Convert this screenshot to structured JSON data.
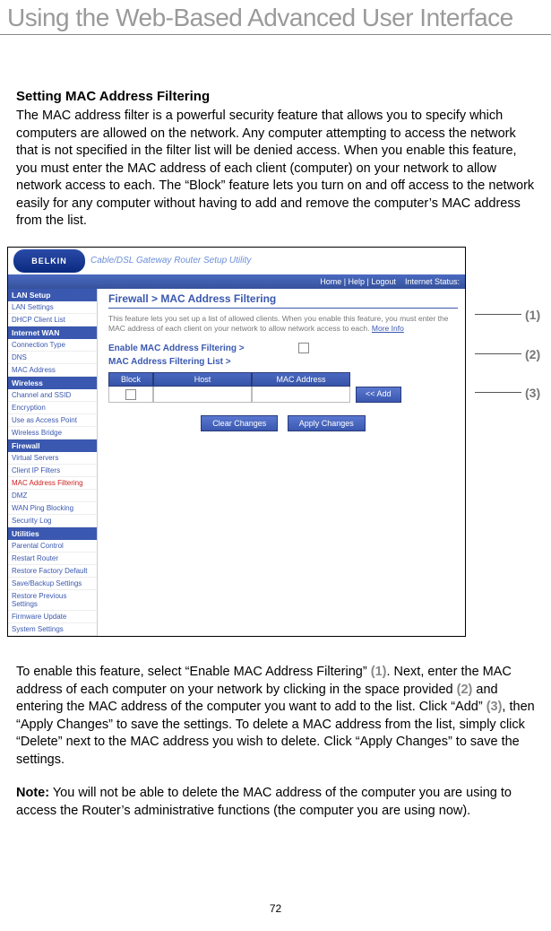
{
  "page": {
    "title": "Using the Web-Based Advanced User Interface",
    "number": "72"
  },
  "section": {
    "heading": "Setting MAC Address Filtering",
    "intro": "The MAC address filter is a powerful security feature that allows you to specify which computers are allowed on the network. Any computer attempting to access the network that is not specified in the filter list will be denied access. When you enable this feature, you must enter the MAC address of each client (computer) on your network to allow network access to each. The “Block” feature lets you turn on and off access to the network easily for any computer without having to add and remove the computer’s MAC address from the list."
  },
  "screenshot": {
    "logo_text": "BELKIN",
    "utility_title": "Cable/DSL Gateway Router Setup Utility",
    "topbar_links": "Home | Help | Logout",
    "topbar_status_label": "Internet Status:",
    "sidebar": {
      "groups": [
        {
          "head": "LAN Setup",
          "items": [
            "LAN Settings",
            "DHCP Client List"
          ]
        },
        {
          "head": "Internet WAN",
          "items": [
            "Connection Type",
            "DNS",
            "MAC Address"
          ]
        },
        {
          "head": "Wireless",
          "items": [
            "Channel and SSID",
            "Encryption",
            "Use as Access Point",
            "Wireless Bridge"
          ]
        },
        {
          "head": "Firewall",
          "items": [
            "Virtual Servers",
            "Client IP Filters",
            "MAC Address Filtering",
            "DMZ",
            "WAN Ping Blocking",
            "Security Log"
          ],
          "selected": "MAC Address Filtering"
        },
        {
          "head": "Utilities",
          "items": [
            "Parental Control",
            "Restart Router",
            "Restore Factory Default",
            "Save/Backup Settings",
            "Restore Previous Settings",
            "Firmware Update",
            "System Settings"
          ]
        }
      ]
    },
    "content": {
      "breadcrumb": "Firewall > MAC Address Filtering",
      "description": "This feature lets you set up a list of allowed clients. When you enable this feature, you must enter the MAC address of each client on your network to allow network access to each.",
      "more_info": "More Info",
      "enable_label": "Enable MAC Address Filtering >",
      "list_label": "MAC Address Filtering List >",
      "table": {
        "col_block": "Block",
        "col_host": "Host",
        "col_mac": "MAC Address"
      },
      "add_button": "<< Add",
      "clear_button": "Clear Changes",
      "apply_button": "Apply Changes"
    },
    "callouts": {
      "c1": "(1)",
      "c2": "(2)",
      "c3": "(3)"
    }
  },
  "instructions": {
    "p1a": "To enable this feature, select “Enable MAC Address Filtering” ",
    "p1b": ". Next, enter the MAC address of each computer on your network by clicking in the space provided ",
    "p1c": " and entering the MAC address of the computer you want to add to the list. Click “Add” ",
    "p1d": ", then “Apply Changes” to save the settings. To delete a MAC address from the list, simply click “Delete” next to the MAC address you wish to delete. Click “Apply Changes” to save the settings.",
    "ref1": "(1)",
    "ref2": "(2)",
    "ref3": "(3)",
    "note_label": "Note:",
    "note_body": " You will not be able to delete the MAC address of the computer you are using to access the Router’s administrative functions (the computer you are using now)."
  }
}
